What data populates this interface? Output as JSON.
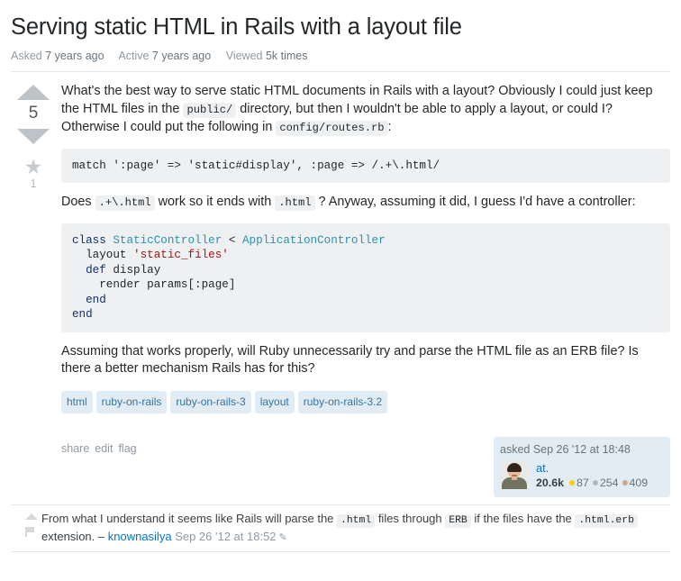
{
  "question": {
    "title": "Serving static HTML in Rails with a layout file",
    "stats": {
      "asked_label": "Asked",
      "asked_value": "7 years ago",
      "active_label": "Active",
      "active_value": "7 years ago",
      "viewed_label": "Viewed",
      "viewed_value": "5k times"
    },
    "votes": {
      "score": "5",
      "favorite_count": "1",
      "upvote_icon": "triangle-up-icon",
      "downvote_icon": "triangle-down-icon",
      "star_icon": "star-icon"
    },
    "body": {
      "para1_a": "What's the best way to serve static HTML documents in Rails with a layout? Obviously I could just keep the HTML files in the ",
      "para1_code1": "public/",
      "para1_b": " directory, but then I wouldn't be able to apply a layout, or could I? Otherwise I could put the following in ",
      "para1_code2": "config/routes.rb",
      "para1_c": ":",
      "code_block_1": "match ':page' => 'static#display', :page => /.+\\.html/",
      "para2_a": "Does ",
      "para2_code1": ".+\\.html",
      "para2_b": " work so it ends with ",
      "para2_code2": ".html",
      "para2_c": " ? Anyway, assuming it did, I guess I'd have a controller:",
      "code_block_2": {
        "line1_k": "class",
        "line1_t1": "StaticController",
        "line1_op": "<",
        "line1_t2": "ApplicationController",
        "line2_pl": "layout",
        "line2_s": "'static_files'",
        "line3_k": "def",
        "line3_pl": "display",
        "line4_pl": "render params[:page]",
        "line5_k": "end",
        "line6_k": "end"
      },
      "para3": "Assuming that works properly, will Ruby unnecessarily try and parse the HTML file as an ERB file? Is there a better mechanism Rails has for this?"
    },
    "tags": [
      "html",
      "ruby-on-rails",
      "ruby-on-rails-3",
      "layout",
      "ruby-on-rails-3.2"
    ],
    "post_menu": {
      "share": "share",
      "edit": "edit",
      "flag": "flag"
    },
    "signature": {
      "action_when": "asked Sep 26 '12 at 18:48",
      "avatar_icon": "user-avatar",
      "username": "at.",
      "reputation": "20.6k",
      "gold": "87",
      "silver": "254",
      "bronze": "409"
    }
  },
  "comments": [
    {
      "upvote_icon": "triangle-up-icon",
      "flag_icon": "flag-icon",
      "text_a": "From what I understand it seems like Rails will parse the ",
      "code1": ".html",
      "text_b": " files through ",
      "code2": "ERB",
      "text_c": " if the files have the ",
      "code3": ".html.erb",
      "text_d": " extension. ",
      "dash": "–",
      "user": "knownasilya",
      "date": "Sep 26 '12 at 18:52",
      "edit_icon": "✎"
    }
  ],
  "colors": {
    "tag_bg": "#e1ecf4",
    "tag_text": "#39739d",
    "link": "#0077cc",
    "code_bg": "#eff0f1",
    "gold": "#ffcc01",
    "silver": "#b4b8bc",
    "bronze": "#d1a684"
  }
}
